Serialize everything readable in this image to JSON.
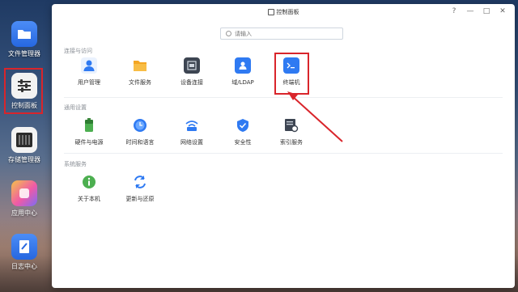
{
  "dock": [
    {
      "label": "文件管理器",
      "icon": "folder-icon"
    },
    {
      "label": "控制面板",
      "icon": "control-panel-icon"
    },
    {
      "label": "存储管理器",
      "icon": "storage-icon"
    },
    {
      "label": "应用中心",
      "icon": "app-center-icon"
    },
    {
      "label": "日志中心",
      "icon": "log-icon"
    }
  ],
  "window": {
    "title": "控制面板",
    "controls": {
      "help": "?",
      "minimize": "—",
      "maximize": "□",
      "close": "✕"
    }
  },
  "search": {
    "placeholder": "请输入"
  },
  "sections": [
    {
      "title": "连接与访问",
      "items": [
        {
          "label": "用户管理",
          "icon": "user-icon"
        },
        {
          "label": "文件服务",
          "icon": "folder-icon"
        },
        {
          "label": "设备连接",
          "icon": "device-icon"
        },
        {
          "label": "域/LDAP",
          "icon": "ldap-icon"
        },
        {
          "label": "终端机",
          "icon": "terminal-icon"
        }
      ]
    },
    {
      "title": "通用设置",
      "items": [
        {
          "label": "硬件与电源",
          "icon": "battery-icon"
        },
        {
          "label": "时间和语言",
          "icon": "clock-icon"
        },
        {
          "label": "网络设置",
          "icon": "wifi-icon"
        },
        {
          "label": "安全性",
          "icon": "shield-icon"
        },
        {
          "label": "索引服务",
          "icon": "index-icon"
        }
      ]
    },
    {
      "title": "系统服务",
      "items": [
        {
          "label": "关于本机",
          "icon": "info-icon"
        },
        {
          "label": "更新与还原",
          "icon": "refresh-icon"
        }
      ]
    }
  ],
  "colors": {
    "highlight": "#d9252b",
    "accent": "#3b82f6"
  }
}
